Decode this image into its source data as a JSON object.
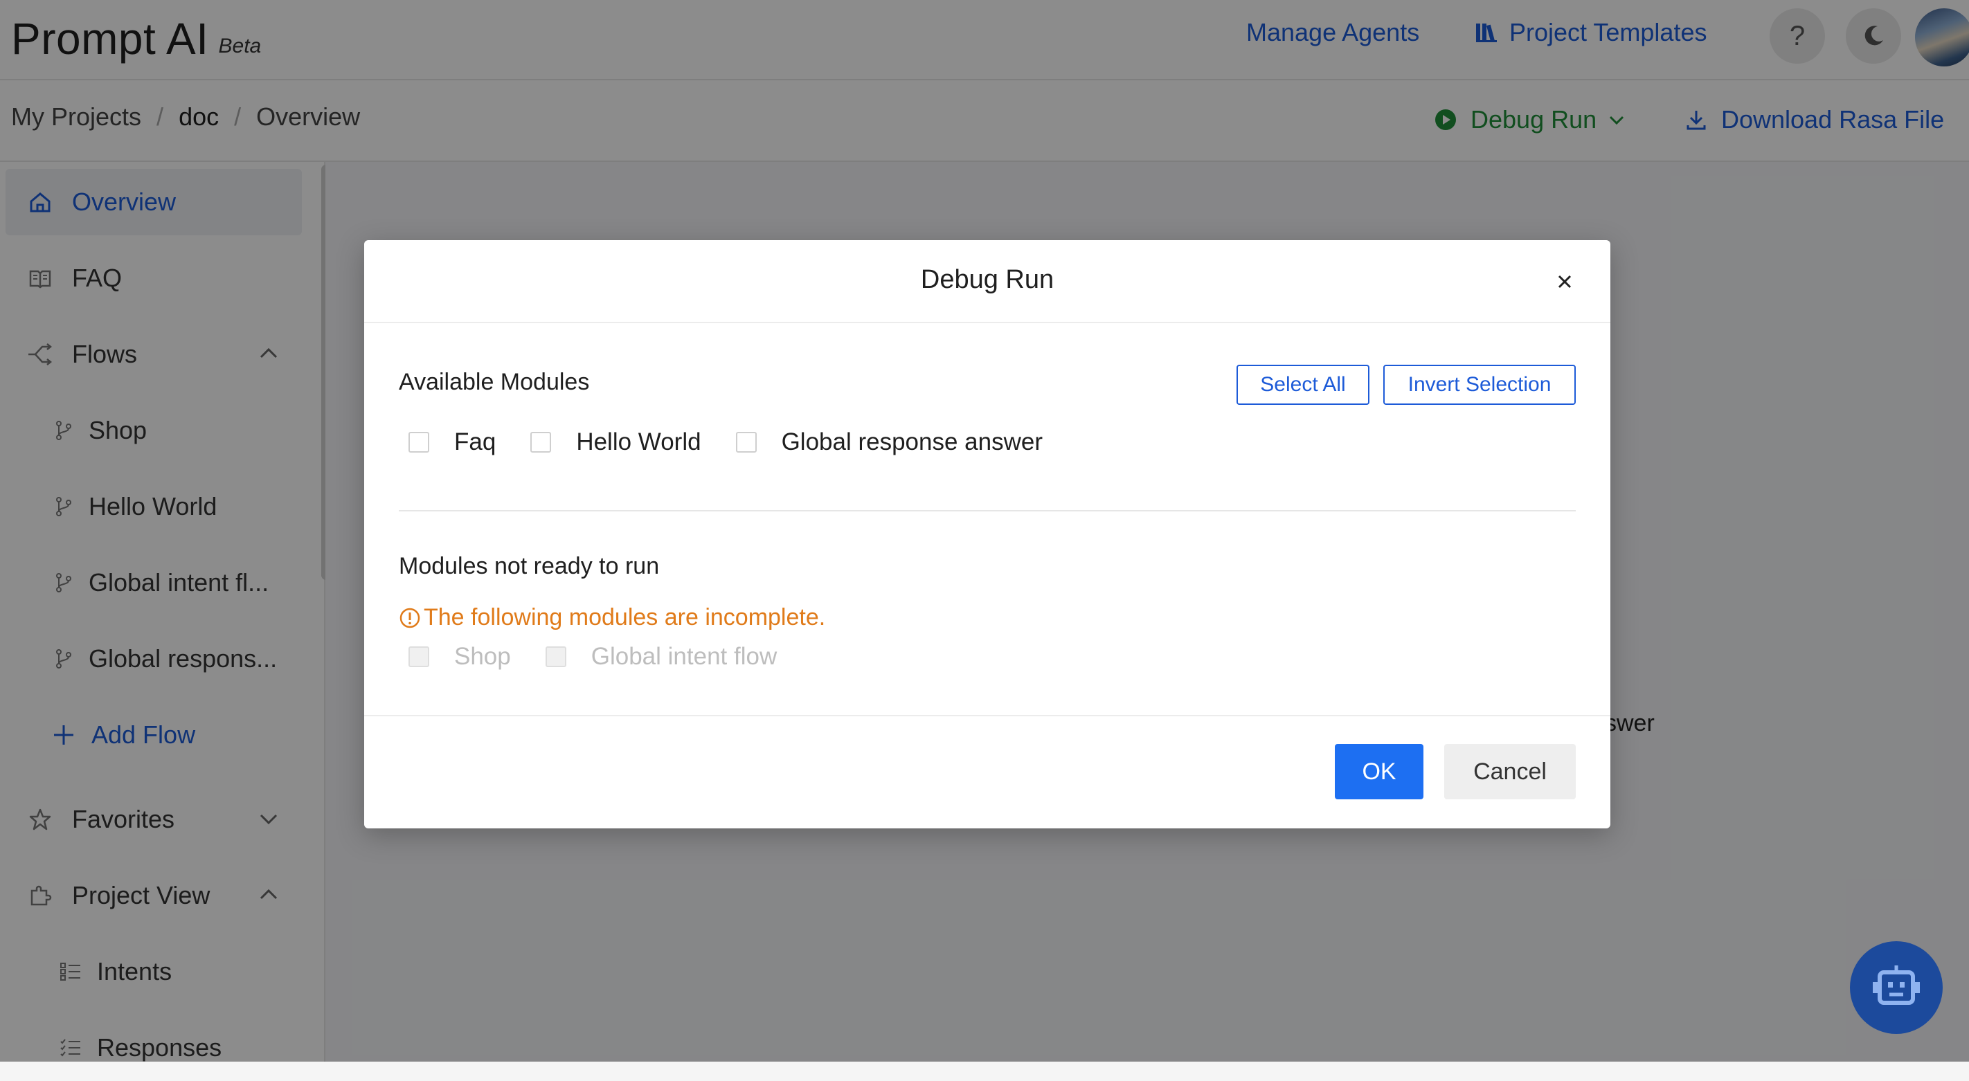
{
  "header": {
    "logo": "Prompt AI",
    "beta": "Beta",
    "manage_agents": "Manage Agents",
    "project_templates": "Project Templates",
    "help_glyph": "?"
  },
  "breadcrumb": {
    "items": [
      "My Projects",
      "doc",
      "Overview"
    ],
    "separator": "/"
  },
  "actions": {
    "debug_run": "Debug Run",
    "download": "Download Rasa File"
  },
  "sidebar": {
    "overview": "Overview",
    "faq": "FAQ",
    "flows": "Flows",
    "flow_items": [
      "Shop",
      "Hello World",
      "Global intent fl...",
      "Global respons..."
    ],
    "add_flow": "Add Flow",
    "favorites": "Favorites",
    "project_view": "Project View",
    "intents": "Intents",
    "responses": "Responses"
  },
  "background": {
    "snippet": "swer"
  },
  "modal": {
    "title": "Debug Run",
    "available_title": "Available Modules",
    "select_all": "Select All",
    "invert_selection": "Invert Selection",
    "available_modules": [
      "Faq",
      "Hello World",
      "Global response answer"
    ],
    "not_ready_title": "Modules not ready to run",
    "warning": "The following modules are incomplete.",
    "incomplete_modules": [
      "Shop",
      "Global intent flow"
    ],
    "ok": "OK",
    "cancel": "Cancel"
  },
  "icons": {
    "templates": "library-icon",
    "theme": "moon-icon",
    "debug": "play-circle-icon",
    "download": "download-icon",
    "bot": "robot-icon"
  },
  "colors": {
    "primary": "#1d5bd8",
    "ok_button": "#1d6ff2",
    "debug_green": "#1f8f3a",
    "warning_orange": "#e07b1a",
    "bot_fab": "#1c4a9c"
  }
}
